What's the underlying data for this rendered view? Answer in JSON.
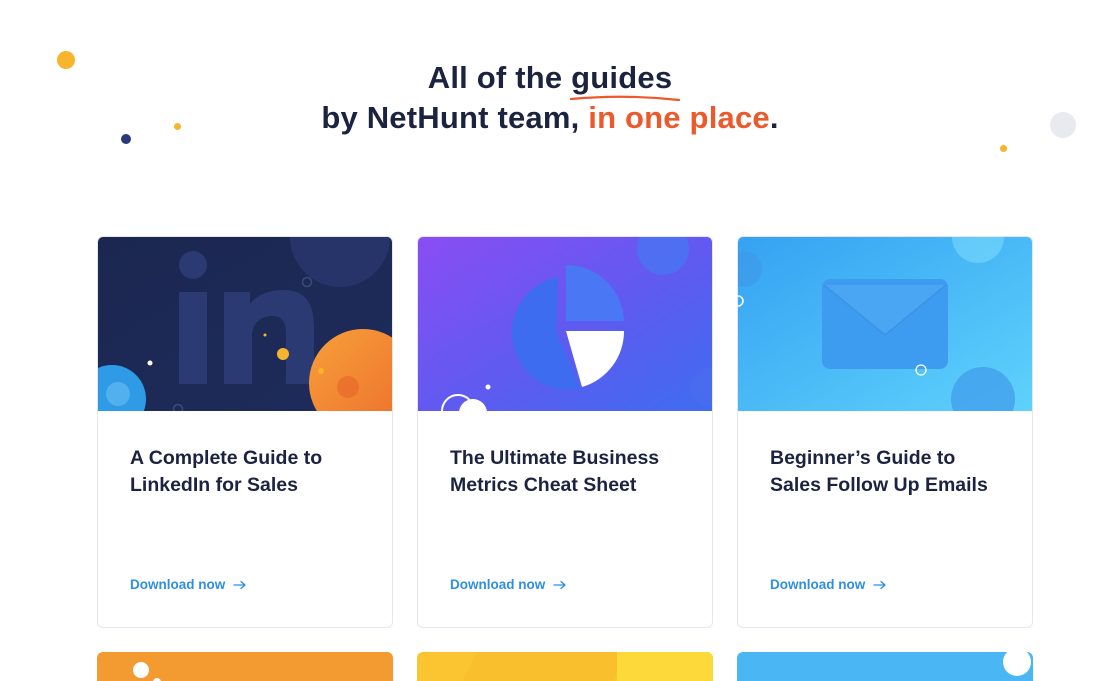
{
  "hero": {
    "line1_pre": "All of the ",
    "line1_underlined": "guides",
    "line2_pre": "by NetHunt team, ",
    "line2_accent": "in one place",
    "line2_post": "."
  },
  "colors": {
    "heading": "#1c2340",
    "accent": "#ec5a2b",
    "link": "#2f8fe0"
  },
  "guides": [
    {
      "title": "A Complete Guide to LinkedIn for Sales",
      "cta": "Download now",
      "icon": "linkedin-logo"
    },
    {
      "title": "The Ultimate Business Metrics Cheat Sheet",
      "cta": "Download now",
      "icon": "pie-chart"
    },
    {
      "title": "Beginner’s Guide to Sales Follow Up Emails",
      "cta": "Download now",
      "icon": "envelope"
    }
  ]
}
